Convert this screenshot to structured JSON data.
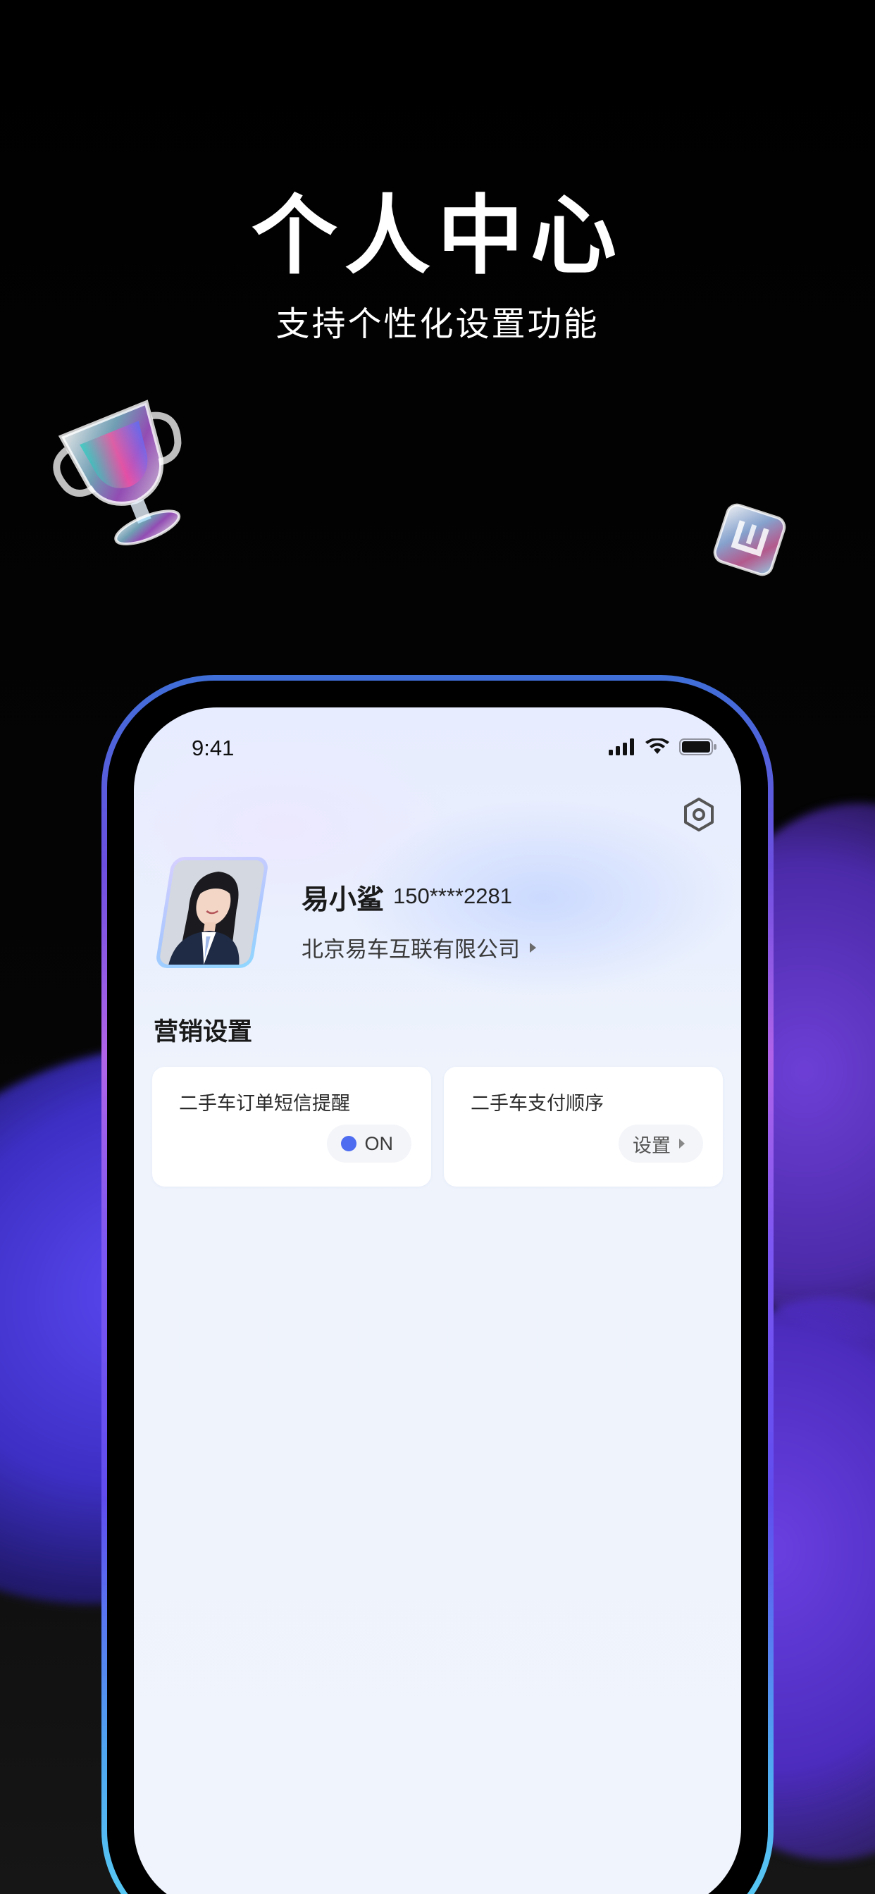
{
  "hero": {
    "title": "个人中心",
    "subtitle": "支持个性化设置功能"
  },
  "status_bar": {
    "time": "9:41",
    "icons": [
      "signal-icon",
      "wifi-icon",
      "battery-icon"
    ]
  },
  "header": {
    "settings_icon": "hexagon-gear-icon"
  },
  "profile": {
    "name": "易小鲨",
    "phone": "150****2281",
    "company": "北京易车互联有限公司"
  },
  "marketing": {
    "section_title": "营销设置",
    "cards": [
      {
        "label": "二手车订单短信提醒",
        "control": "toggle",
        "value": "ON",
        "state": "on"
      },
      {
        "label": "二手车支付顺序",
        "control": "button",
        "value": "设置"
      }
    ]
  },
  "colors": {
    "toggle_on": "#4d6cf0",
    "phone_frame_gradient": [
      "#3f6fd8",
      "#b163e8",
      "#5f4cef",
      "#5ad3f5"
    ],
    "background": "#000000"
  }
}
